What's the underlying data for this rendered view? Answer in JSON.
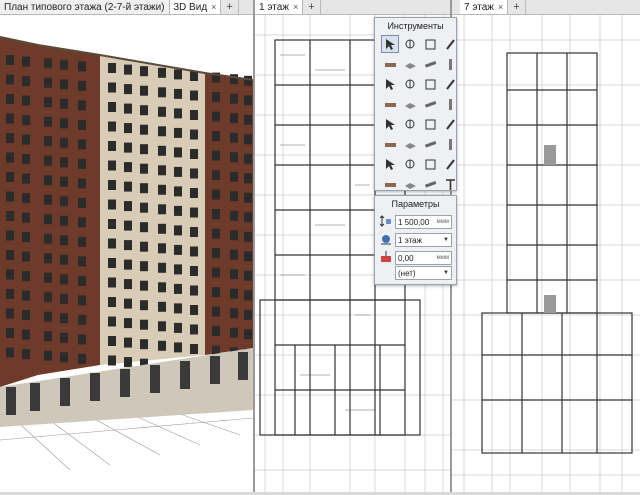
{
  "left_pane": {
    "tabs": [
      {
        "label": "План типового этажа (2-7-й этажи)",
        "active": false
      },
      {
        "label": "3D Вид",
        "active": true
      }
    ],
    "add_tab": "+"
  },
  "middle_pane": {
    "tabs": [
      {
        "label": "1 этаж",
        "active": true
      }
    ],
    "add_tab": "+"
  },
  "right_pane": {
    "tabs": [
      {
        "label": "7 этаж",
        "active": true
      }
    ],
    "add_tab": "+"
  },
  "close_glyph": "×",
  "tools_palette": {
    "title": "Инструменты",
    "tools": [
      "arrow-select-icon",
      "magic-wand-icon",
      "rectangle-icon",
      "pencil-icon",
      "wall-icon",
      "slab-icon",
      "beam-icon",
      "column-icon",
      "door-icon",
      "window-icon",
      "stair-icon",
      "railing-icon",
      "roof-icon",
      "line-icon",
      "zone-icon",
      "text-annotation-icon",
      "object-icon",
      "fill-icon",
      "curtain-wall-icon",
      "morph-icon",
      "shell-icon",
      "lamp-icon",
      "mesh-icon",
      "label-icon",
      "section-icon",
      "elevation-icon",
      "detail-icon",
      "worksheet-icon",
      "dimension-icon",
      "level-icon",
      "camera-icon",
      "text-icon"
    ],
    "selected": "arrow-select-icon"
  },
  "params_panel": {
    "title": "Параметры",
    "height_value": "1 500,00",
    "height_unit": "ммм",
    "story_value": "1 этаж",
    "offset_value": "0,00",
    "offset_unit": "ммм",
    "layer_value": "(нет)",
    "dropdown_glyph": "▼"
  },
  "colors": {
    "brick": "#6e3a2a",
    "facade_beige": "#d8ccb6",
    "window_dark": "#2b2b2b",
    "plan_line": "#333333",
    "palette_bg": "#eef0f3"
  }
}
